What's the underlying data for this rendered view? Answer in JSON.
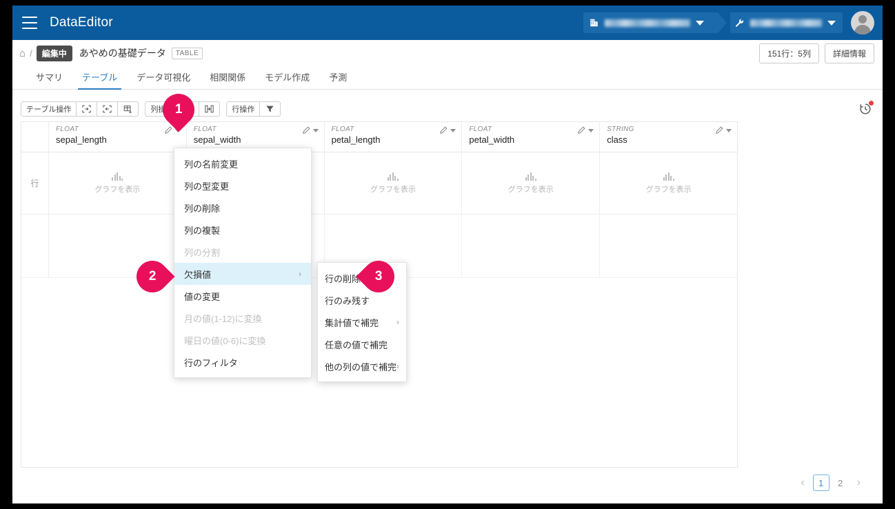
{
  "app": {
    "title": "DataEditor",
    "menu_icon": "hamburger-icon"
  },
  "topbar": {
    "org_selector": {
      "icon": "building-icon",
      "label": "",
      "caret": "▾"
    },
    "project_selector": {
      "icon": "wrench-icon",
      "label": "",
      "caret": "▾"
    },
    "avatar": "user-avatar"
  },
  "breadcrumb": {
    "home_icon": "⌂",
    "separator": "/",
    "status_badge": "編集中",
    "title": "あやめの基礎データ",
    "type_tag": "TABLE",
    "size_button": "151行：5列",
    "detail_button": "詳細情報"
  },
  "tabs": [
    {
      "label": "サマリ",
      "active": false
    },
    {
      "label": "テーブル",
      "active": true
    },
    {
      "label": "データ可視化",
      "active": false
    },
    {
      "label": "相関関係",
      "active": false
    },
    {
      "label": "モデル作成",
      "active": false
    },
    {
      "label": "予測",
      "active": false
    }
  ],
  "toolbar": {
    "table_ops_label": "テーブル操作",
    "column_ops_label": "列操作",
    "row_ops_label": "行操作",
    "table_op_icons": [
      "expand-columns-icon",
      "shrink-columns-icon",
      "add-table-icon"
    ],
    "column_op_icons": [
      "edit-column-icon",
      "insert-column-icon"
    ],
    "row_filter_icon": "filter-icon",
    "history_icon": "history-clock-icon",
    "history_has_notification": true
  },
  "table": {
    "row_header_label": "行",
    "chart_cell_label": "グラフを表示",
    "chart_cell_icon": "bar-chart-icon",
    "columns": [
      {
        "type": "FLOAT",
        "name": "sepal_length"
      },
      {
        "type": "FLOAT",
        "name": "sepal_width"
      },
      {
        "type": "FLOAT",
        "name": "petal_length"
      },
      {
        "type": "FLOAT",
        "name": "petal_width"
      },
      {
        "type": "STRING",
        "name": "class"
      }
    ],
    "header_action_icons": [
      "pencil-icon",
      "chevron-down-icon"
    ]
  },
  "column_menu": {
    "items": [
      {
        "label": "列の名前変更",
        "disabled": false,
        "highlighted": false,
        "submenu": false
      },
      {
        "label": "列の型変更",
        "disabled": false,
        "highlighted": false,
        "submenu": false
      },
      {
        "label": "列の削除",
        "disabled": false,
        "highlighted": false,
        "submenu": false
      },
      {
        "label": "列の複製",
        "disabled": false,
        "highlighted": false,
        "submenu": false
      },
      {
        "label": "列の分割",
        "disabled": true,
        "highlighted": false,
        "submenu": false
      },
      {
        "label": "欠損値",
        "disabled": false,
        "highlighted": true,
        "submenu": true
      },
      {
        "label": "値の変更",
        "disabled": false,
        "highlighted": false,
        "submenu": false
      },
      {
        "label": "月の値(1-12)に変換",
        "disabled": true,
        "highlighted": false,
        "submenu": false
      },
      {
        "label": "曜日の値(0-6)に変換",
        "disabled": true,
        "highlighted": false,
        "submenu": false
      },
      {
        "label": "行のフィルタ",
        "disabled": false,
        "highlighted": false,
        "submenu": false
      }
    ],
    "submenu_arrow": "›"
  },
  "missing_value_submenu": {
    "items": [
      {
        "label": "行の削除",
        "submenu": false
      },
      {
        "label": "行のみ残す",
        "submenu": false
      },
      {
        "label": "集計値で補完",
        "submenu": true
      },
      {
        "label": "任意の値で補完",
        "submenu": false
      },
      {
        "label": "他の列の値で補完",
        "submenu": true
      }
    ],
    "submenu_arrow": "›"
  },
  "pagination": {
    "prev_icon": "‹",
    "next_icon": "›",
    "pages": [
      "1",
      "2"
    ],
    "current": "1"
  },
  "step_badges": [
    {
      "number": "1",
      "direction": "down"
    },
    {
      "number": "2",
      "direction": "right"
    },
    {
      "number": "3",
      "direction": "left"
    }
  ],
  "colors": {
    "topbar": "#0b5c9e",
    "accent": "#2a7fc2",
    "badge": "#e8105a",
    "highlight": "#ddf1fb",
    "notification": "#e8413c"
  }
}
